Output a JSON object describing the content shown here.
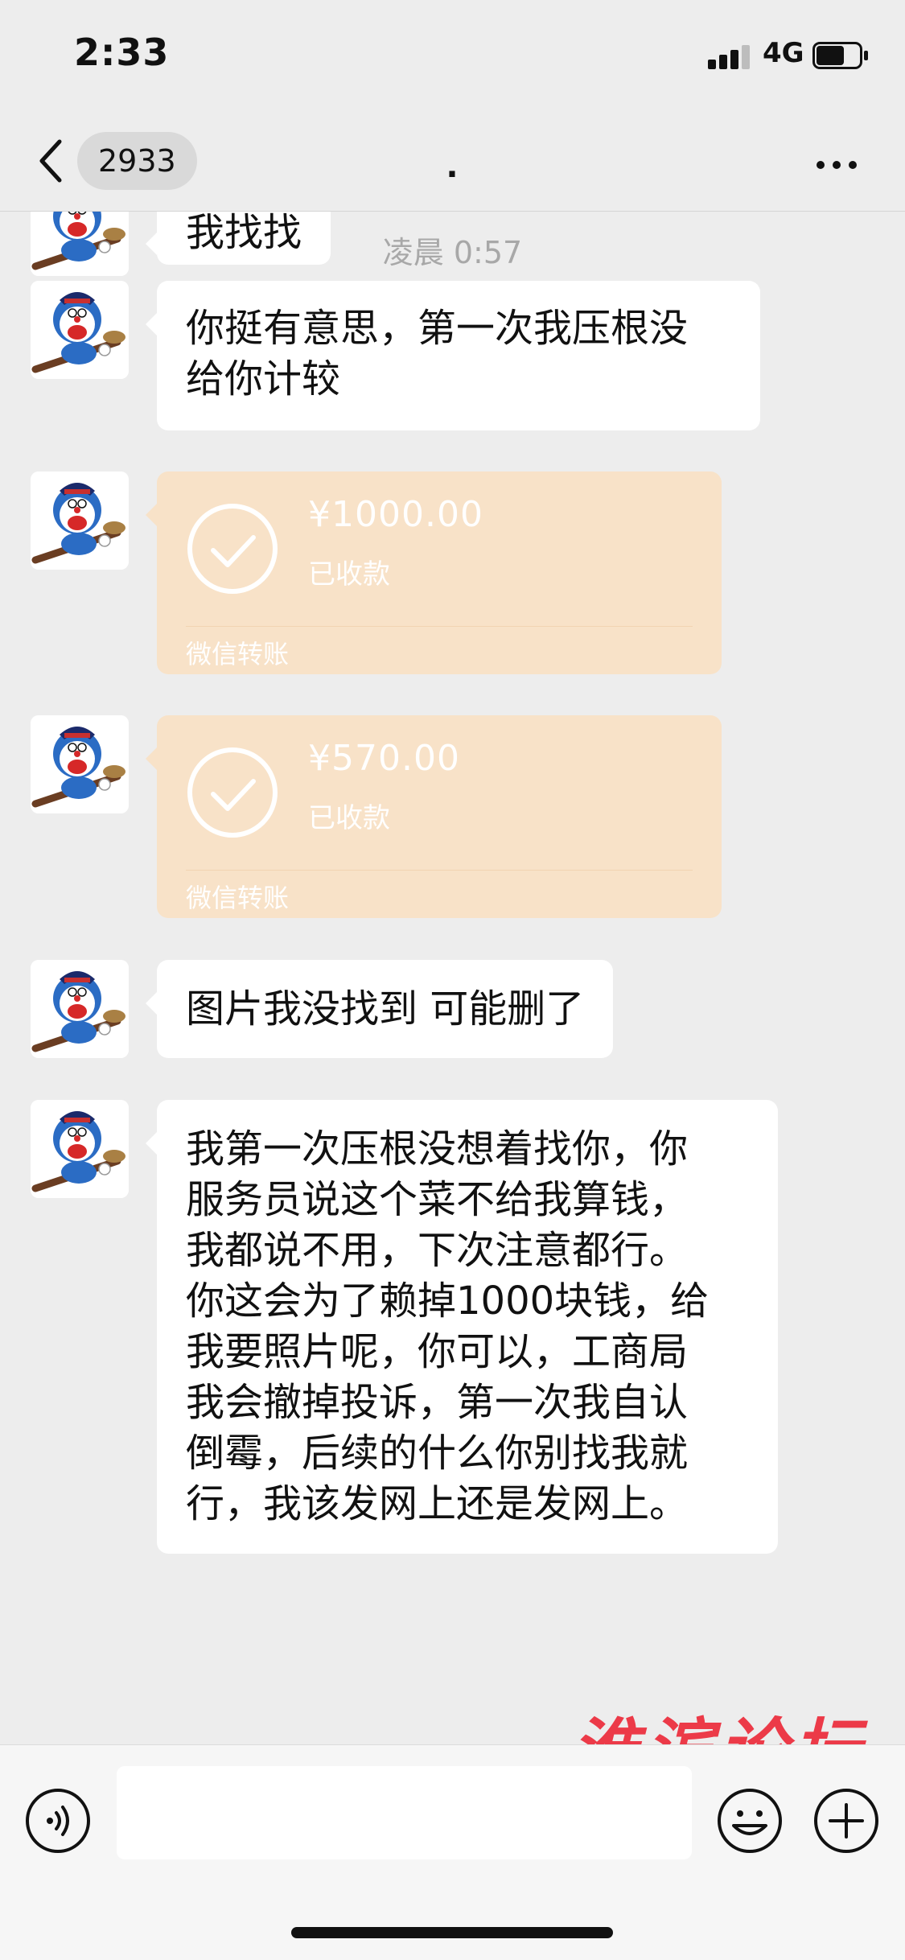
{
  "status_bar": {
    "time": "2:33",
    "network": "4G"
  },
  "nav": {
    "unread_count": "2933",
    "title": "."
  },
  "messages": [
    {
      "type": "text",
      "text": "我找找"
    },
    {
      "type": "time",
      "text": "凌晨 0:57"
    },
    {
      "type": "text",
      "lines": [
        "你挺有意思，第一次我压根没",
        "给你计较"
      ]
    },
    {
      "type": "transfer",
      "amount": "¥1000.00",
      "status": "已收款",
      "source": "微信转账"
    },
    {
      "type": "transfer",
      "amount": "¥570.00",
      "status": "已收款",
      "source": "微信转账"
    },
    {
      "type": "text",
      "text": "图片我没找到 可能删了"
    },
    {
      "type": "text",
      "lines": [
        "我第一次压根没想着找你，你",
        "服务员说这个菜不给我算钱，",
        "我都说不用，下次注意都行。",
        "你这会为了赖掉1000块钱，给",
        "我要照片呢，你可以，工商局",
        "我会撤掉投诉，第一次我自认",
        "倒霉，后续的什么你别找我就",
        "行，我该发网上还是发网上。"
      ]
    }
  ],
  "input": {
    "value": ""
  },
  "watermark": "淮滨论坛",
  "colors": {
    "background": "#ededed",
    "bubble": "#ffffff",
    "transfer": "#f8e2c8",
    "watermark": "#ec3a48"
  },
  "icons": [
    "back-icon",
    "more-icon",
    "voice-icon",
    "emoji-icon",
    "plus-icon",
    "check-icon"
  ]
}
